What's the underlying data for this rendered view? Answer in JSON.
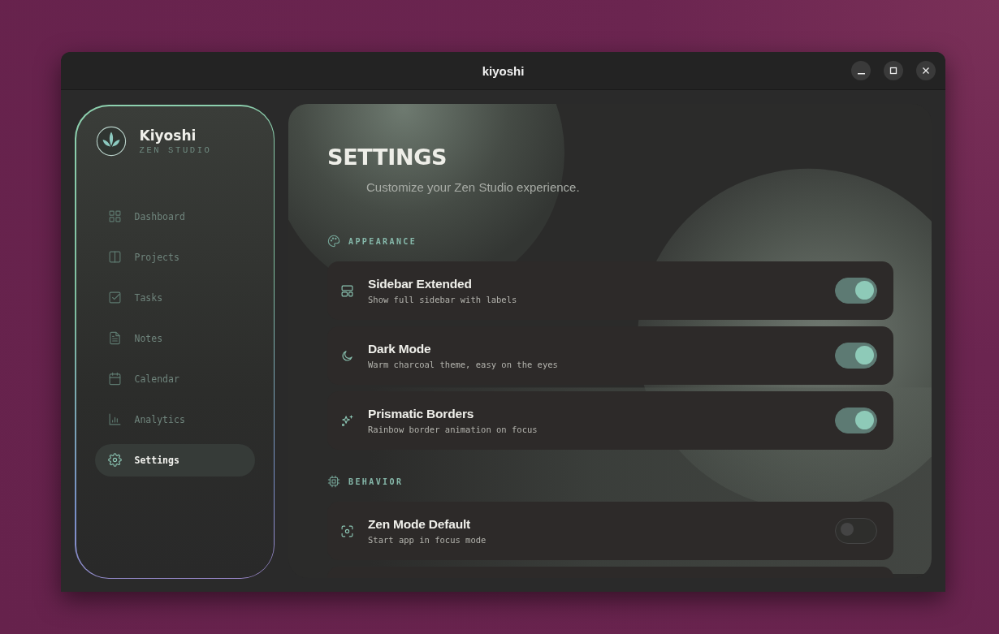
{
  "window": {
    "title": "kiyoshi"
  },
  "brand": {
    "name": "Kiyoshi",
    "tagline": "ZEN STUDIO"
  },
  "sidebar": {
    "items": [
      {
        "label": "Dashboard",
        "selected": false
      },
      {
        "label": "Projects",
        "selected": false
      },
      {
        "label": "Tasks",
        "selected": false
      },
      {
        "label": "Notes",
        "selected": false
      },
      {
        "label": "Calendar",
        "selected": false
      },
      {
        "label": "Analytics",
        "selected": false
      },
      {
        "label": "Settings",
        "selected": true
      }
    ]
  },
  "page": {
    "title": "SETTINGS",
    "subtitle": "Customize your Zen Studio experience."
  },
  "sections": [
    {
      "title": "APPEARANCE",
      "items": [
        {
          "title": "Sidebar Extended",
          "description": "Show full sidebar with labels",
          "on": true
        },
        {
          "title": "Dark Mode",
          "description": "Warm charcoal theme, easy on the eyes",
          "on": true
        },
        {
          "title": "Prismatic Borders",
          "description": "Rainbow border animation on focus",
          "on": true
        }
      ]
    },
    {
      "title": "BEHAVIOR",
      "items": [
        {
          "title": "Zen Mode Default",
          "description": "Start app in focus mode",
          "on": false
        }
      ]
    }
  ]
}
